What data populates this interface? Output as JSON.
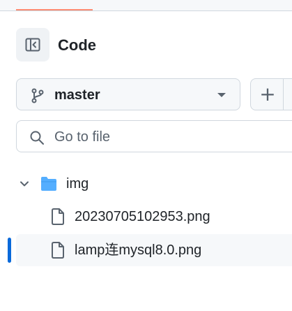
{
  "panel": {
    "title": "Code"
  },
  "branch": {
    "name": "master"
  },
  "actions": {
    "add_glyph": "+"
  },
  "search": {
    "placeholder": "Go to file"
  },
  "tree": {
    "folder": {
      "name": "img",
      "expanded": true
    },
    "files": [
      {
        "name": "20230705102953.png",
        "selected": false
      },
      {
        "name": "lamp连mysql8.0.png",
        "selected": true
      }
    ]
  },
  "colors": {
    "accent_tab": "#fd8c73",
    "selection": "#0969da",
    "folder": "#54aeff",
    "muted": "#59636e",
    "border": "#d0d7de"
  }
}
